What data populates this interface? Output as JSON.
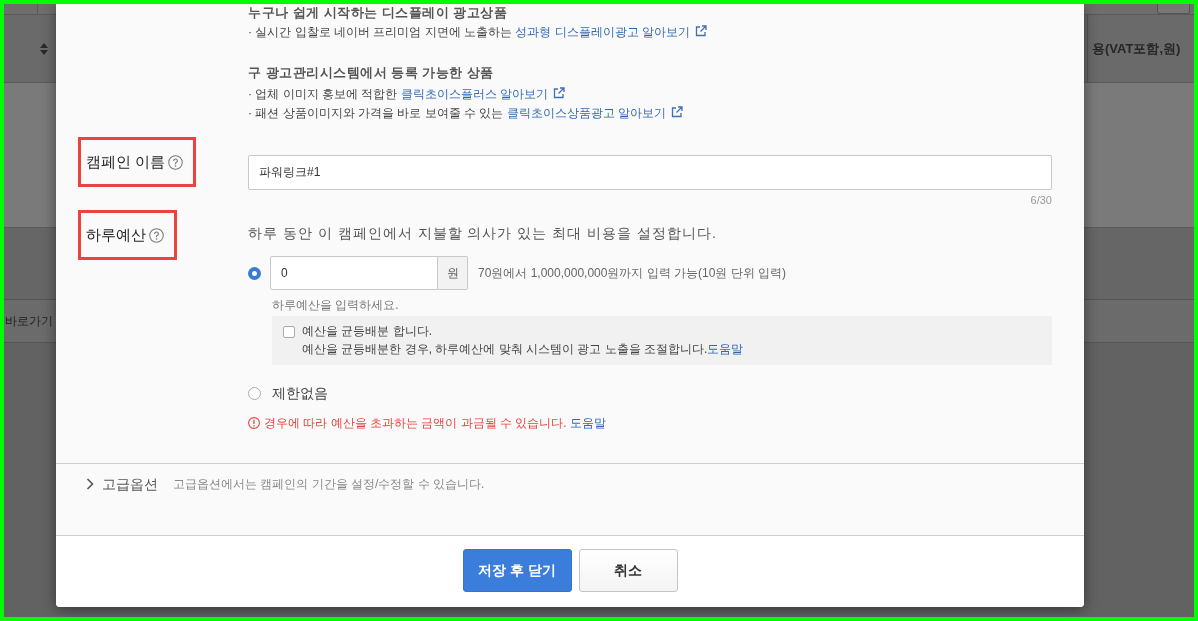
{
  "background_page": {
    "table_header": "용(VAT포함,원)",
    "shortcut_button": "바로가기"
  },
  "modal": {
    "product_sections": [
      {
        "title": "누구나 쉽게 시작하는 디스플레이 광고상품",
        "items": [
          {
            "text": "· 실시간 입찰로 네이버 프리미엄 지면에 노출하는",
            "link": "성과형 디스플레이광고 알아보기"
          }
        ]
      },
      {
        "title": "구 광고관리시스템에서 등록 가능한 상품",
        "items": [
          {
            "text": "· 업체 이미지 홍보에 적합한",
            "link": "클릭초이스플러스 알아보기"
          },
          {
            "text": "· 패션 상품이미지와 가격을 바로 보여줄 수 있는",
            "link": "클릭초이스상품광고 알아보기"
          }
        ]
      }
    ],
    "campaign_name": {
      "label": "캠페인 이름",
      "highlighted": true,
      "value": "파워링크#1",
      "counter": "6/30"
    },
    "daily_budget": {
      "label": "하루예산",
      "highlighted": true,
      "description": "하루 동안 이 캠페인에서 지불할 의사가 있는 최대 비용을 설정합니다.",
      "options": [
        {
          "kind": "amount",
          "selected": true,
          "value": "0",
          "unit": "원",
          "range_hint": "70원에서 1,000,000,000원까지 입력 가능(10원 단위 입력)",
          "hint": "하루예산을 입력하세요.",
          "even_distribution": {
            "checked": false,
            "label": "예산을 균등배분 합니다.",
            "description": "예산을 균등배분한 경우, 하루예산에 맞춰 시스템이 광고 노출을 조절합니다.",
            "link": "도움말"
          }
        },
        {
          "kind": "unlimited",
          "selected": false,
          "label": "제한없음"
        }
      ],
      "warning": {
        "text": "경우에 따라 예산을 초과하는 금액이 과금될 수 있습니다.",
        "link": "도움말"
      }
    },
    "advanced_options": {
      "label": "고급옵션",
      "expanded": false,
      "description": "고급옵션에서는 캠페인의 기간을 설정/수정할 수 있습니다."
    },
    "buttons": [
      {
        "label": "저장 후 닫기",
        "kind": "primary"
      },
      {
        "label": "취소",
        "kind": "secondary"
      }
    ]
  }
}
